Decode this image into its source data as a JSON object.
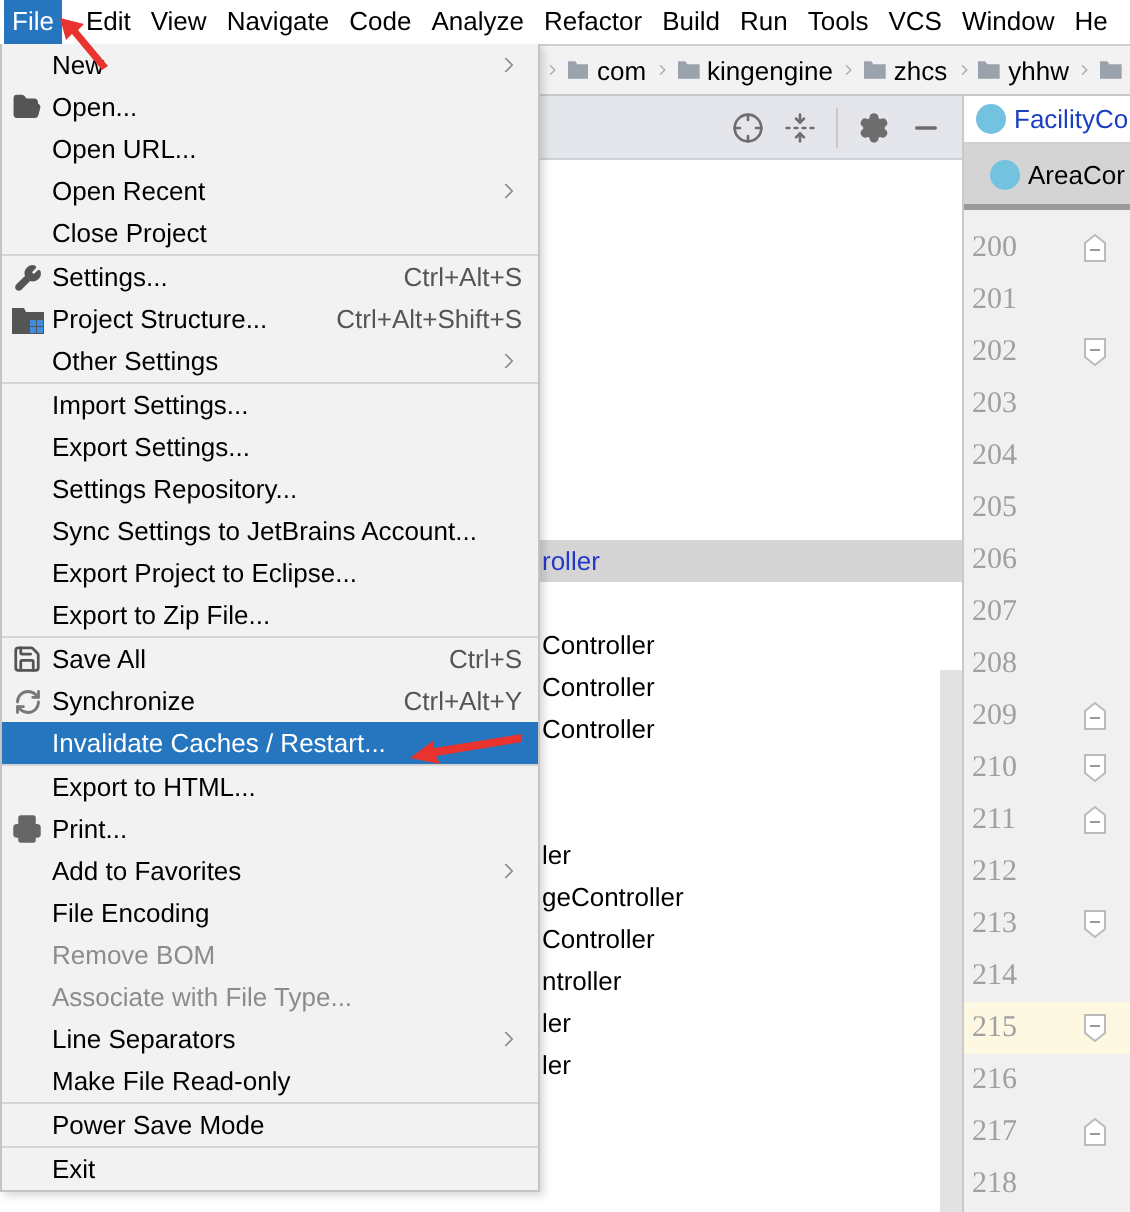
{
  "menu_bar": [
    {
      "label": "File",
      "selected": true
    },
    {
      "label": "Edit",
      "selected": false
    },
    {
      "label": "View",
      "selected": false
    },
    {
      "label": "Navigate",
      "selected": false
    },
    {
      "label": "Code",
      "selected": false
    },
    {
      "label": "Analyze",
      "selected": false
    },
    {
      "label": "Refactor",
      "selected": false
    },
    {
      "label": "Build",
      "selected": false
    },
    {
      "label": "Run",
      "selected": false
    },
    {
      "label": "Tools",
      "selected": false
    },
    {
      "label": "VCS",
      "selected": false
    },
    {
      "label": "Window",
      "selected": false
    },
    {
      "label": "He",
      "selected": false
    }
  ],
  "breadcrumb": [
    "com",
    "kingengine",
    "zhcs",
    "yhhw"
  ],
  "project_tree": {
    "groups": [
      [
        {
          "label": "roller",
          "selected": true
        }
      ],
      [
        {
          "label": "Controller",
          "selected": false
        },
        {
          "label": "Controller",
          "selected": false
        },
        {
          "label": "Controller",
          "selected": false
        }
      ],
      [
        {
          "label": "ler",
          "selected": false
        },
        {
          "label": "geController",
          "selected": false
        },
        {
          "label": "Controller",
          "selected": false
        },
        {
          "label": "ntroller",
          "selected": false
        },
        {
          "label": "ler",
          "selected": false
        },
        {
          "label": "ler",
          "selected": false
        }
      ]
    ]
  },
  "editor": {
    "tabs": [
      {
        "label": "FacilityCo",
        "selected": true
      },
      {
        "label": "AreaCor",
        "selected": false
      }
    ],
    "lines": [
      {
        "number": "200",
        "kind": "foldend",
        "current": false
      },
      {
        "number": "201",
        "kind": "plain",
        "current": false
      },
      {
        "number": "202",
        "kind": "foldstart",
        "current": false
      },
      {
        "number": "203",
        "kind": "plain",
        "current": false
      },
      {
        "number": "204",
        "kind": "plain",
        "current": false
      },
      {
        "number": "205",
        "kind": "plain",
        "current": false
      },
      {
        "number": "206",
        "kind": "plain",
        "current": false
      },
      {
        "number": "207",
        "kind": "plain",
        "current": false
      },
      {
        "number": "208",
        "kind": "plain",
        "current": false
      },
      {
        "number": "209",
        "kind": "foldend",
        "current": false
      },
      {
        "number": "210",
        "kind": "foldstart",
        "current": false
      },
      {
        "number": "211",
        "kind": "foldend",
        "current": false
      },
      {
        "number": "212",
        "kind": "plain",
        "current": false
      },
      {
        "number": "213",
        "kind": "foldstart",
        "current": false
      },
      {
        "number": "214",
        "kind": "plain",
        "current": false
      },
      {
        "number": "215",
        "kind": "foldstart",
        "current": true
      },
      {
        "number": "216",
        "kind": "plain",
        "current": false
      },
      {
        "number": "217",
        "kind": "foldend",
        "current": false
      },
      {
        "number": "218",
        "kind": "plain",
        "current": false
      }
    ]
  },
  "file_menu": {
    "groups": [
      {
        "items": [
          {
            "label": "New",
            "submenu": true,
            "disabled": false,
            "selected": false
          },
          {
            "label": "Open...",
            "submenu": false,
            "disabled": false,
            "selected": false
          },
          {
            "label": "Open URL...",
            "submenu": false,
            "disabled": false,
            "selected": false
          },
          {
            "label": "Open Recent",
            "submenu": true,
            "disabled": false,
            "selected": false
          },
          {
            "label": "Close Project",
            "submenu": false,
            "disabled": false,
            "selected": false
          }
        ]
      },
      {
        "items": [
          {
            "label": "Settings...",
            "shortcut": "Ctrl+Alt+S",
            "submenu": false,
            "disabled": false,
            "selected": false
          },
          {
            "label": "Project Structure...",
            "shortcut": "Ctrl+Alt+Shift+S",
            "submenu": false,
            "disabled": false,
            "selected": false
          },
          {
            "label": "Other Settings",
            "submenu": true,
            "disabled": false,
            "selected": false
          }
        ]
      },
      {
        "items": [
          {
            "label": "Import Settings...",
            "submenu": false,
            "disabled": false,
            "selected": false
          },
          {
            "label": "Export Settings...",
            "submenu": false,
            "disabled": false,
            "selected": false
          },
          {
            "label": "Settings Repository...",
            "submenu": false,
            "disabled": false,
            "selected": false
          },
          {
            "label": "Sync Settings to JetBrains Account...",
            "submenu": false,
            "disabled": false,
            "selected": false
          },
          {
            "label": "Export Project to Eclipse...",
            "submenu": false,
            "disabled": false,
            "selected": false
          },
          {
            "label": "Export to Zip File...",
            "submenu": false,
            "disabled": false,
            "selected": false
          }
        ]
      },
      {
        "items": [
          {
            "label": "Save All",
            "shortcut": "Ctrl+S",
            "submenu": false,
            "disabled": false,
            "selected": false
          },
          {
            "label": "Synchronize",
            "shortcut": "Ctrl+Alt+Y",
            "submenu": false,
            "disabled": false,
            "selected": false
          },
          {
            "label": "Invalidate Caches / Restart...",
            "submenu": false,
            "disabled": false,
            "selected": true
          }
        ]
      },
      {
        "items": [
          {
            "label": "Export to HTML...",
            "submenu": false,
            "disabled": false,
            "selected": false
          },
          {
            "label": "Print...",
            "submenu": false,
            "disabled": false,
            "selected": false
          },
          {
            "label": "Add to Favorites",
            "submenu": true,
            "disabled": false,
            "selected": false
          },
          {
            "label": "File Encoding",
            "submenu": false,
            "disabled": false,
            "selected": false
          },
          {
            "label": "Remove BOM",
            "submenu": false,
            "disabled": true,
            "selected": false
          },
          {
            "label": "Associate with File Type...",
            "submenu": false,
            "disabled": true,
            "selected": false
          },
          {
            "label": "Line Separators",
            "submenu": true,
            "disabled": false,
            "selected": false
          },
          {
            "label": "Make File Read-only",
            "submenu": false,
            "disabled": false,
            "selected": false
          }
        ]
      },
      {
        "items": [
          {
            "label": "Power Save Mode",
            "submenu": false,
            "disabled": false,
            "selected": false
          }
        ]
      },
      {
        "items": [
          {
            "label": "Exit",
            "submenu": false,
            "disabled": false,
            "selected": false
          }
        ]
      }
    ]
  }
}
